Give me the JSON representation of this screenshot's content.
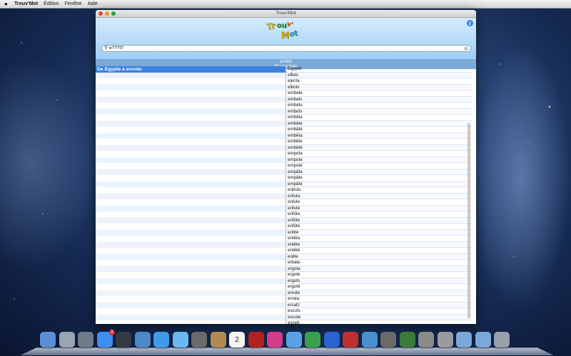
{
  "menubar": {
    "apple": "",
    "app_name": "Trouv'Mot",
    "items": [
      "Édition",
      "Fenêtre",
      "Aide"
    ]
  },
  "window": {
    "title": "Trouv'Mot",
    "logo_text": "Trouv'Mot",
    "info_label": "i",
    "search_value": "e???t?",
    "status_line1": "arrêté",
    "status_line2": "50 résultats",
    "selected_range": "De Egypte à exvoto",
    "results": [
      "Egypte",
      "effets",
      "ejecta",
      "elbots",
      "embate",
      "embats",
      "embatu",
      "embuts",
      "embâta",
      "embâte",
      "embâté",
      "embêta",
      "embête",
      "embêté",
      "empota",
      "empote",
      "empoté",
      "empâta",
      "empâte",
      "empâté",
      "enbuts",
      "enfuta",
      "enfute",
      "enfuté",
      "enfûta",
      "enfûte",
      "enfûté",
      "entité",
      "entêta",
      "entête",
      "entêté",
      "eolite",
      "erbate",
      "ergota",
      "ergote",
      "ergots",
      "ergoté",
      "ermite",
      "errata",
      "ersatz",
      "escots",
      "escute",
      "eszett"
    ]
  },
  "dock": {
    "icons": [
      "finder-icon",
      "launchpad-icon",
      "mission-control-icon",
      "app-store-icon",
      "dashboard-icon",
      "preview-icon",
      "safari-icon",
      "messages-icon",
      "facetime-icon",
      "contacts-icon",
      "calendar-icon",
      "photo-booth-icon",
      "itunes-icon",
      "maps-icon",
      "game-icon",
      "music-icon",
      "photo-icon",
      "iphoto-icon",
      "imovie-icon",
      "time-machine-icon",
      "system-prefs-icon",
      "utilities-icon",
      "applications-folder-icon",
      "downloads-folder-icon",
      "trash-icon"
    ],
    "calendar_day": "2",
    "app_store_badge": "3"
  },
  "colors": {
    "selection": "#3d80df",
    "header_top": "#d6ecfc",
    "header_bottom": "#9fcdf6"
  }
}
